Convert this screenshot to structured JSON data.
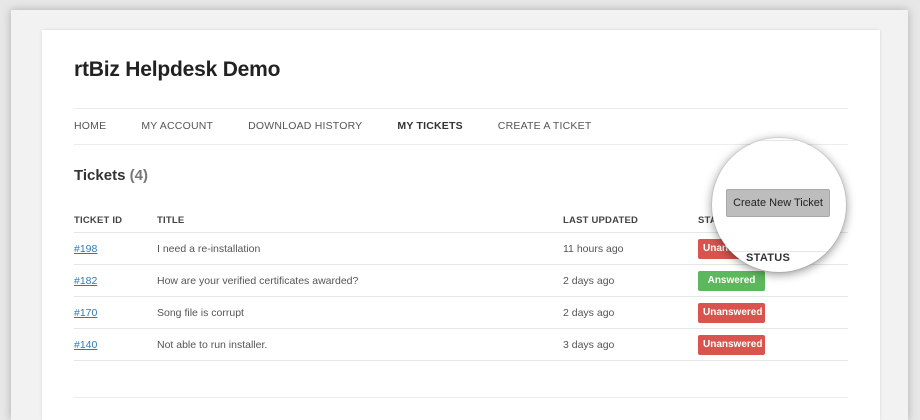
{
  "site": {
    "title": "rtBiz Helpdesk Demo"
  },
  "nav": {
    "items": [
      {
        "label": "HOME"
      },
      {
        "label": "MY ACCOUNT"
      },
      {
        "label": "DOWNLOAD HISTORY"
      },
      {
        "label": "MY TICKETS",
        "active": true
      },
      {
        "label": "CREATE A TICKET"
      }
    ]
  },
  "tickets": {
    "heading": "Tickets",
    "count": "(4)",
    "create_button_label": "Create New Ticket",
    "columns": {
      "id": "TICKET ID",
      "title": "TITLE",
      "updated": "LAST UPDATED",
      "status": "STATUS"
    },
    "rows": [
      {
        "id": "#198",
        "title": "I need a re-installation",
        "updated": "11 hours ago",
        "status": "Unanswered",
        "status_color": "#d9534f"
      },
      {
        "id": "#182",
        "title": "How are your verified certificates awarded?",
        "updated": "2 days ago",
        "status": "Answered",
        "status_color": "#5cb85c"
      },
      {
        "id": "#170",
        "title": "Song file is corrupt",
        "updated": "2 days ago",
        "status": "Unanswered",
        "status_color": "#d9534f"
      },
      {
        "id": "#140",
        "title": "Not able to run installer.",
        "updated": "3 days ago",
        "status": "Unanswered",
        "status_color": "#d9534f"
      }
    ]
  },
  "colors": {
    "link": "#2c7ab6",
    "unanswered": "#d9534f",
    "answered": "#5cb85c",
    "button_bg": "#bdbdbd"
  }
}
